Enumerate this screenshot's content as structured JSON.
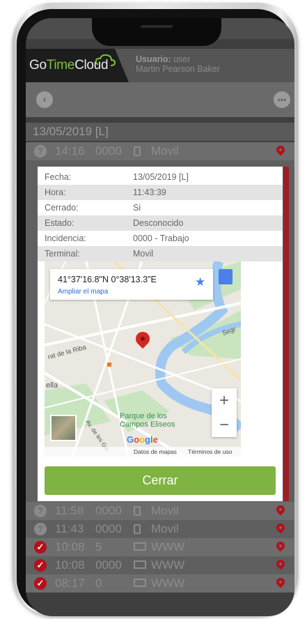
{
  "app": {
    "logo_go": "Go",
    "logo_time": "Time",
    "logo_cloud": "Cloud",
    "user_label": "Usuario:",
    "user_name": "user",
    "full_name": "Martin Pearson Baker"
  },
  "day_header": "13/05/2019 [L]",
  "first_row": {
    "time": "14:16",
    "code": "0000",
    "terminal": "Movil"
  },
  "bottom_rows": [
    {
      "time": "11:58",
      "code": "0000",
      "terminal": "Movil",
      "status": "question"
    },
    {
      "time": "11:43",
      "code": "0000",
      "terminal": "Movil",
      "status": "question"
    },
    {
      "time": "10:08",
      "code": "5",
      "terminal": "WWW",
      "status": "check"
    },
    {
      "time": "10:08",
      "code": "0000",
      "terminal": "WWW",
      "status": "check"
    },
    {
      "time": "08:17",
      "code": "0",
      "terminal": "WWW",
      "status": "check"
    }
  ],
  "detail": [
    {
      "key": "Fecha:",
      "value": "13/05/2019 [L]"
    },
    {
      "key": "Hora:",
      "value": "11:43:39"
    },
    {
      "key": "Cerrado:",
      "value": "Si"
    },
    {
      "key": "Estado:",
      "value": "Desconocido"
    },
    {
      "key": "Incidencia:",
      "value": "0000 - Trabajo"
    },
    {
      "key": "Terminal:",
      "value": "Movil"
    }
  ],
  "map": {
    "coordinates": "41°37'16.8\"N 0°38'13.3\"E",
    "enlarge_link": "Ampliar el mapa",
    "park_line1": "Parque de los",
    "park_line2": "Campos Eliseos",
    "label_riba": "rat de la Riba",
    "label_ella": "ella",
    "label_seg": "Segr",
    "label_av": "Av. de les Gar",
    "google": "Google",
    "map_data": "Datos de mapas",
    "terms": "Términos de uso",
    "zoom_in": "+",
    "zoom_out": "−"
  },
  "close_label": "Cerrar",
  "icons": {
    "back": "chevron-left-icon",
    "more": "more-dots-icon",
    "status_unknown": "question-icon",
    "status_ok": "check-icon",
    "mobile": "mobile-phone-icon",
    "desktop": "monitor-icon",
    "location": "location-pin-icon"
  },
  "colors": {
    "accent_green": "#7fb342",
    "alert_red": "#b4101a",
    "link_blue": "#2a6ed6"
  }
}
